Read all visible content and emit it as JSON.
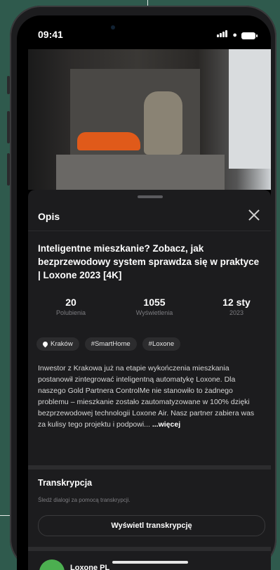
{
  "status_bar": {
    "time": "09:41"
  },
  "sheet": {
    "title": "Opis",
    "video_title": "Inteligentne mieszkanie? Zobacz, jak bezprzewodowy system sprawdza się w praktyce | Loxone 2023 [4K]",
    "stats": [
      {
        "value": "20",
        "label": "Polubienia"
      },
      {
        "value": "1055",
        "label": "Wyświetlenia"
      },
      {
        "value": "12 sty",
        "label": "2023"
      }
    ],
    "tags": [
      "Kraków",
      "#SmartHome",
      "#Loxone"
    ],
    "description": "Inwestor z Krakowa już na etapie wykończenia mieszkania postanowił zintegrować inteligentną automatykę Loxone. Dla naszego Gold Partnera ControlMe nie stanowiło to żadnego problemu – mieszkanie zostało zautomatyzowane w 100% dzięki bezprzewodowej technologii Loxone Air. Nasz partner zabiera was za kulisy tego projektu i podpowi...",
    "more_label": "...więcej"
  },
  "transcript": {
    "title": "Transkrypcja",
    "subtitle": "Śledź dialogi za pomocą transkrypcji.",
    "button_label": "Wyświetl transkrypcję"
  },
  "channel": {
    "name": "Loxone PL"
  }
}
